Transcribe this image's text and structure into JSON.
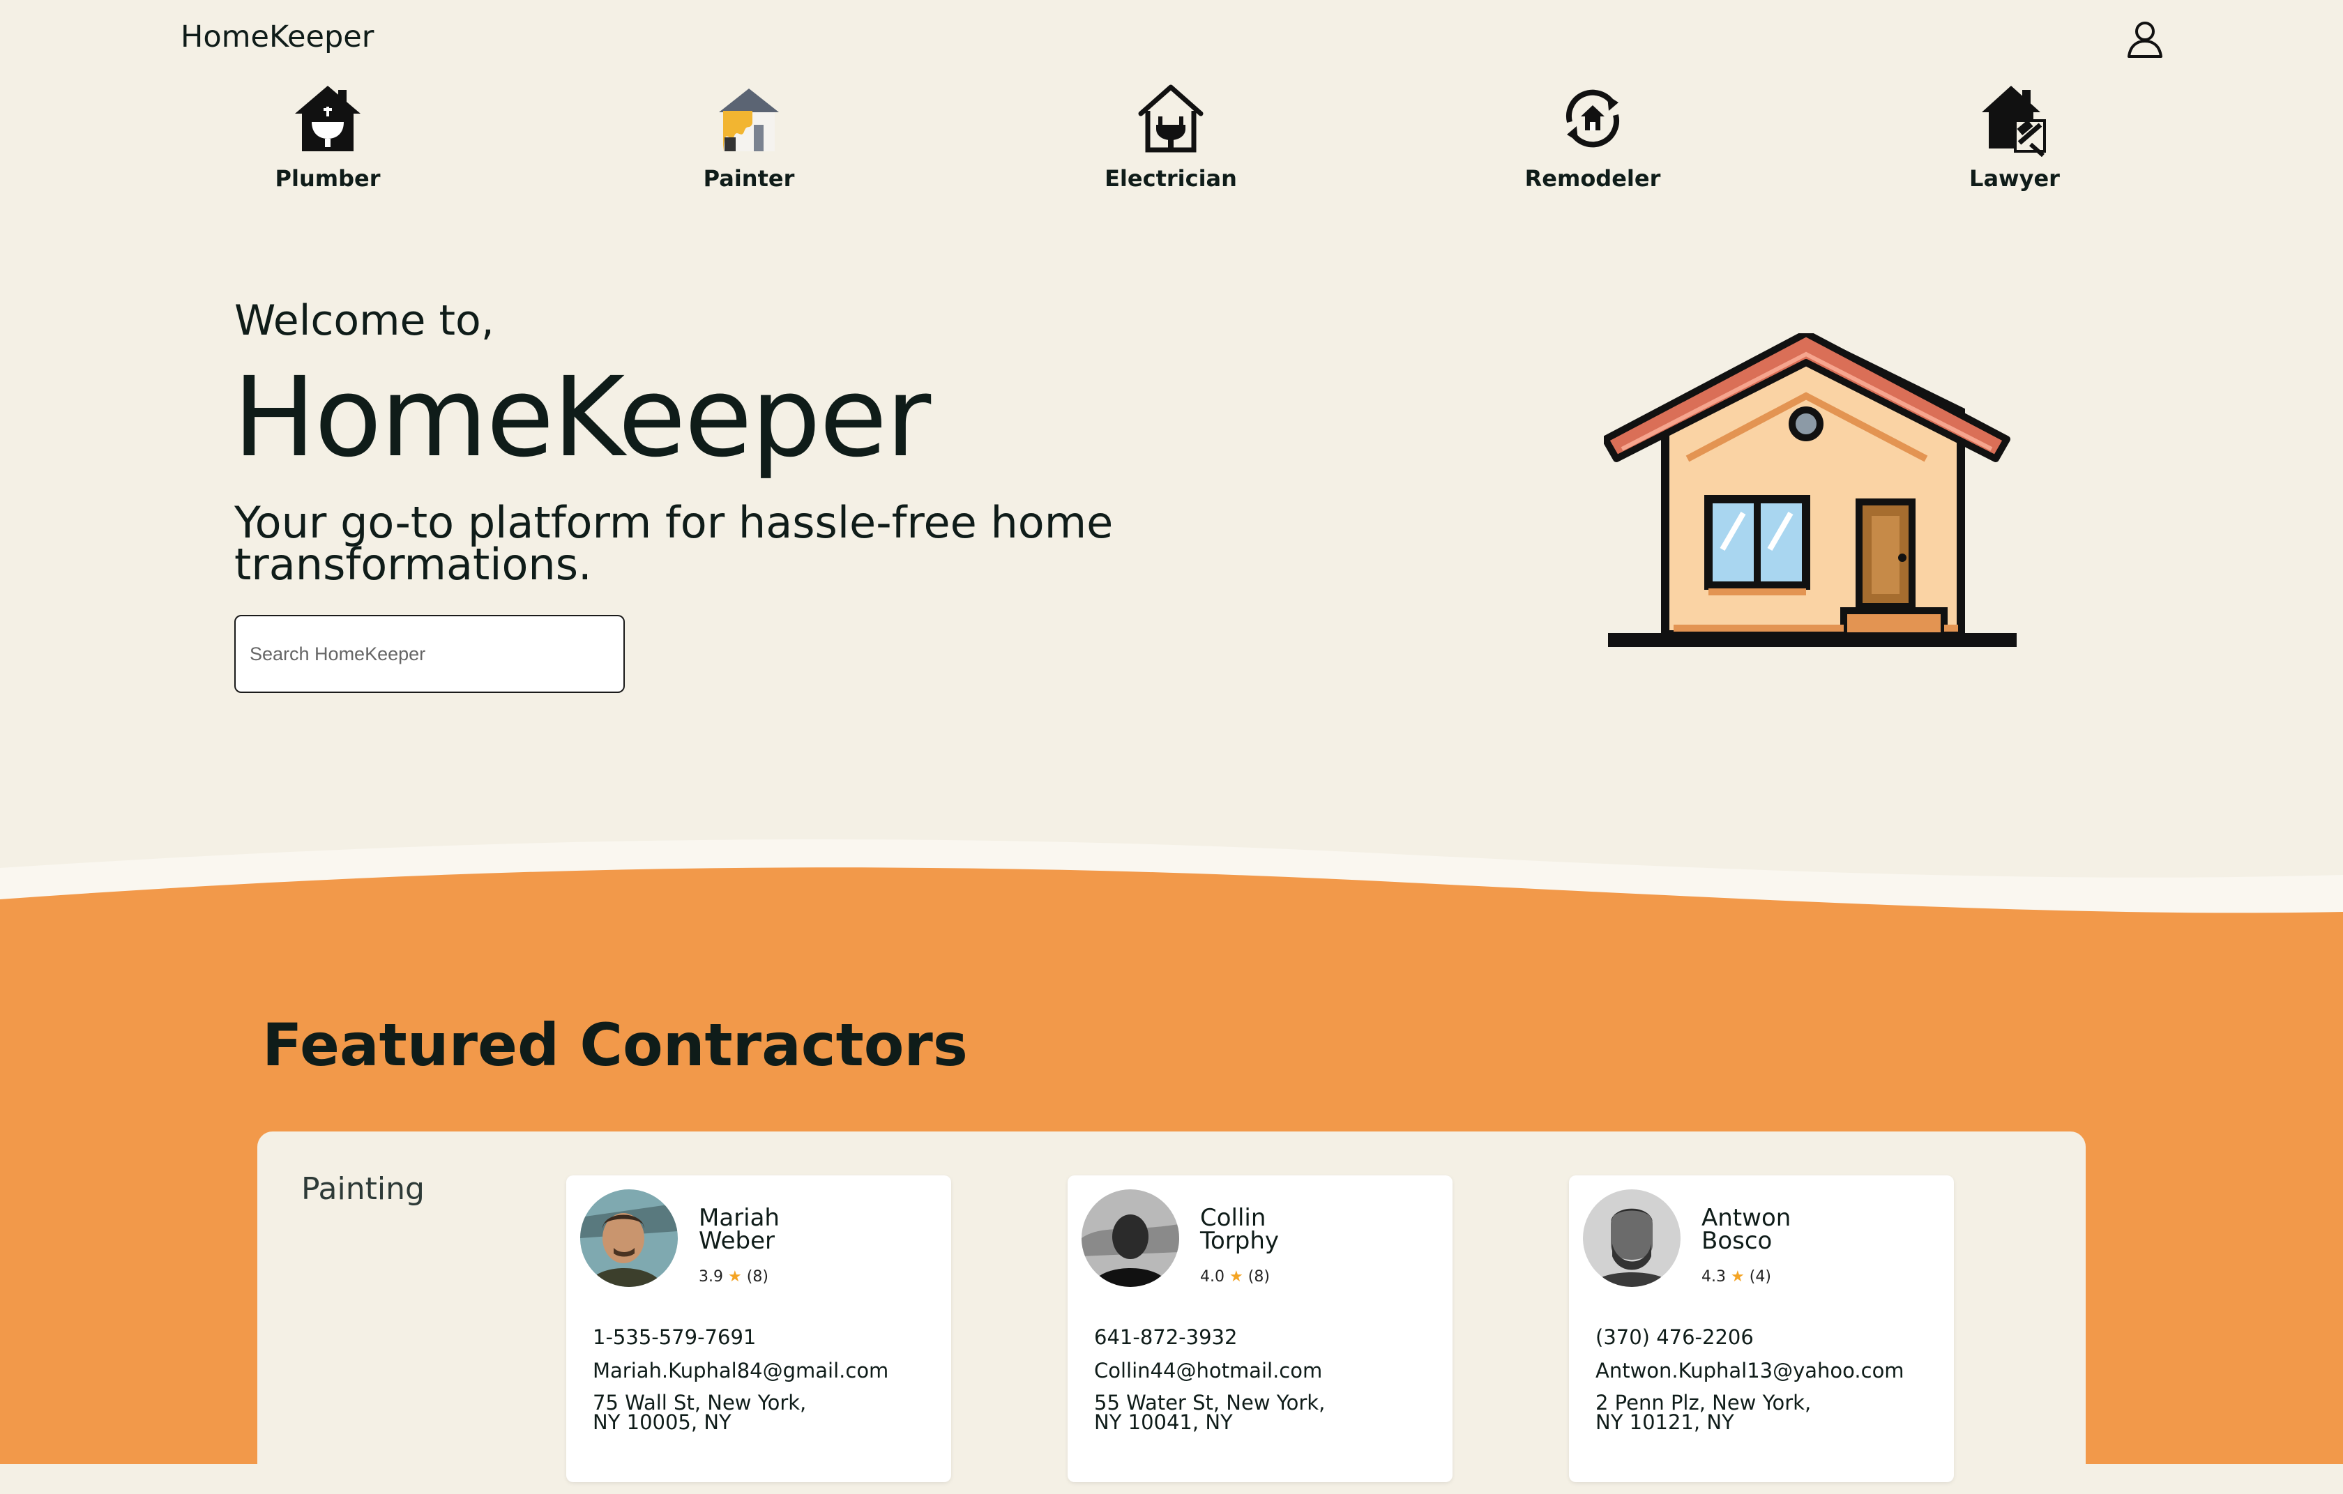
{
  "header": {
    "brand": "HomeKeeper",
    "user_icon": "user-icon"
  },
  "categories": [
    {
      "label": "Plumber",
      "icon": "plumber-house-sink-icon"
    },
    {
      "label": "Painter",
      "icon": "painter-house-icon"
    },
    {
      "label": "Electrician",
      "icon": "electrician-house-plug-icon"
    },
    {
      "label": "Remodeler",
      "icon": "remodeler-refresh-house-icon"
    },
    {
      "label": "Lawyer",
      "icon": "lawyer-house-gavel-icon"
    }
  ],
  "hero": {
    "welcome": "Welcome to,",
    "title": "HomeKeeper",
    "tagline": "Your go-to platform for hassle-free home transformations.",
    "search_placeholder": "Search HomeKeeper",
    "illustration": "house-illustration"
  },
  "featured": {
    "title": "Featured Contractors",
    "category": "Painting",
    "contractors": [
      {
        "first": "Mariah",
        "last": "Weber",
        "rating": "3.9",
        "reviews": "(8)",
        "phone": "1-535-579-7691",
        "email": "Mariah.Kuphal84@gmail.com",
        "address_line1": "75 Wall St, New York,",
        "address_line2": "NY 10005, NY"
      },
      {
        "first": "Collin",
        "last": "Torphy",
        "rating": "4.0",
        "reviews": "(8)",
        "phone": "641-872-3932",
        "email": "Collin44@hotmail.com",
        "address_line1": "55 Water St, New York,",
        "address_line2": "NY 10041, NY"
      },
      {
        "first": "Antwon",
        "last": "Bosco",
        "rating": "4.3",
        "reviews": "(4)",
        "phone": "(370) 476-2206",
        "email": "Antwon.Kuphal13@yahoo.com",
        "address_line1": "2 Penn Plz, New York,",
        "address_line2": "NY 10121, NY"
      }
    ]
  },
  "colors": {
    "background": "#f4f0e5",
    "accent_orange": "#f2994a",
    "text_dark": "#0f1c19",
    "star": "#f4a424"
  }
}
